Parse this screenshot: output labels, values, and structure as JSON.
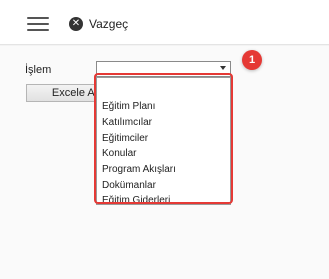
{
  "toolbar": {
    "menu_icon": "hamburger-menu-icon",
    "cancel_icon": "close-circle-icon",
    "cancel_glyph": "✕",
    "cancel_label": "Vazgeç"
  },
  "form": {
    "field_label": "İşlem",
    "select_value": "",
    "excel_button_label": "Excele Aktar"
  },
  "dropdown": {
    "items": [
      "",
      "Eğitim Planı",
      "Katılımcılar",
      "Eğitimciler",
      "Konular",
      "Program Akışları",
      "Dokümanlar",
      "Eğitim Giderleri"
    ]
  },
  "annotation": {
    "badge": "1",
    "color": "#e53935"
  }
}
